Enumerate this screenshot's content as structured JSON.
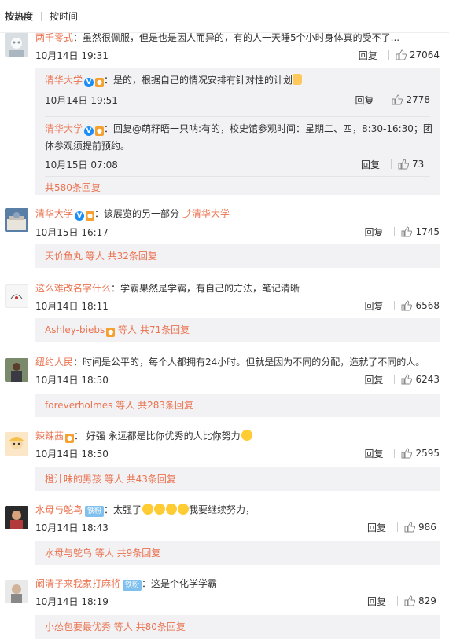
{
  "sort": {
    "hot": "按热度",
    "time": "按时间"
  },
  "comments": [
    {
      "user": "两千零式",
      "text": "：虽然很佩服，但是也是因人而异的，有的人一天睡5个小时身体真的受不了...",
      "time": "10月14日 19:31",
      "reply": "回复",
      "likes": "27064",
      "subs": [
        {
          "user": "清华大学",
          "text": "：是的，根据自己的情况安排有针对性的计划",
          "time": "10月14日 19:51",
          "reply": "回复",
          "likes": "2778"
        },
        {
          "user": "清华大学",
          "text_line1": "：回复@萌籽晤一只呐:有的，校史馆参观时间：星期二、四，8:30-16:30；团",
          "text_line2": "体参观须提前预约。",
          "time": "10月15日 07:08",
          "reply": "回复",
          "likes": "73"
        }
      ],
      "more": "共580条回复"
    },
    {
      "user": "清华大学",
      "text": "：该展览的另一部分",
      "link": "清华大学",
      "time": "10月15日 16:17",
      "reply": "回复",
      "likes": "1745",
      "more_user": "天价鱼丸",
      "more": " 等人 共32条回复"
    },
    {
      "user": "这么难改名字什么",
      "text": "：学霸果然是学霸，有自己的方法，笔记清晰",
      "time": "10月14日 18:11",
      "reply": "回复",
      "likes": "6568",
      "more_user": "Ashley-biebs",
      "more": " 等人 共71条回复"
    },
    {
      "user": "纽约人民",
      "text": "：时间是公平的，每个人都拥有24小时。但就是因为不同的分配，造就了不同的人。",
      "time": "10月14日 18:50",
      "reply": "回复",
      "likes": "6243",
      "more_user": "foreverholmes",
      "more": " 等人 共283条回复"
    },
    {
      "user": "辣辣茜",
      "text": "： 好强 永远都是比你优秀的人比你努力",
      "time": "10月14日 18:50",
      "reply": "回复",
      "likes": "2595",
      "more_user": "橙汁味的男孩",
      "more": " 等人 共43条回复"
    },
    {
      "user": "水母与鸵鸟",
      "fan": "铁粉",
      "text": "：太强了",
      "text2": "我要继续努力，",
      "time": "10月14日 18:43",
      "reply": "回复",
      "likes": "986",
      "more_user": "水母与鸵鸟",
      "more": " 等人 共9条回复"
    },
    {
      "user": "阚清子来我家打麻将",
      "fan": "铁粉",
      "text": "：这是个化学学霸",
      "time": "10月14日 18:19",
      "reply": "回复",
      "likes": "829",
      "more_user": "小怂包要最优秀",
      "more": " 等人 共80条回复"
    }
  ],
  "colors": {
    "username": "#eb7350",
    "subbox": "#f2f2f5",
    "verified": "#1a8ef5"
  }
}
